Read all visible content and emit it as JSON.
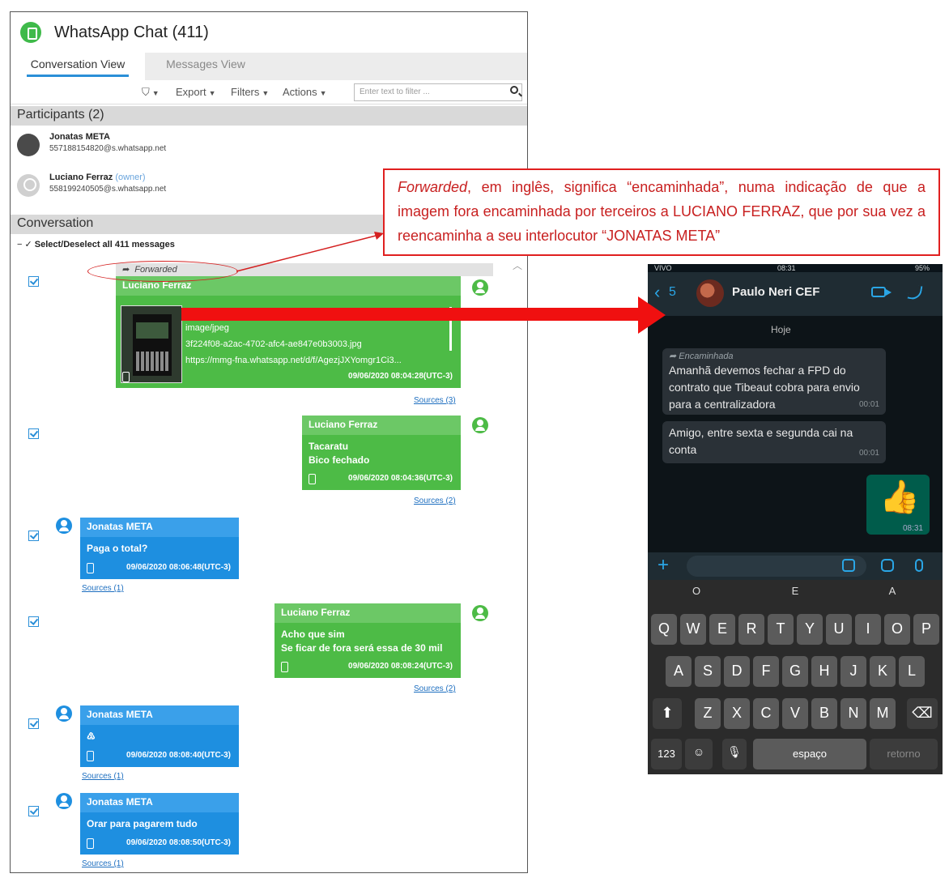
{
  "app": {
    "title": "WhatsApp Chat",
    "count": "(411)"
  },
  "tabs": [
    {
      "label": "Conversation View"
    },
    {
      "label": "Messages View"
    }
  ],
  "toolbar": {
    "export": "Export",
    "filters": "Filters",
    "actions": "Actions",
    "filter_placeholder": "Enter text to filter ..."
  },
  "participants": {
    "heading": "Participants (2)",
    "items": [
      {
        "name": "Jonatas META",
        "number": "557188154820@s.whatsapp.net",
        "tag": ""
      },
      {
        "name": "Luciano Ferraz",
        "number": "558199240505@s.whatsapp.net",
        "tag": "(owner)"
      }
    ]
  },
  "conversation": {
    "heading": "Conversation",
    "select_all": "Select/Deselect all 411 messages",
    "forwarded_label": "Forwarded",
    "messages": [
      {
        "sender": "Luciano Ferraz",
        "attachment_type": "image/jpeg",
        "attachment_file": "3f224f08-a2ac-4702-afc4-ae847e0b3003.jpg",
        "attachment_url": "https://mmg-fna.whatsapp.net/d/f/AgezjJXYomgr1Ci3...",
        "timestamp": "09/06/2020 08:04:28(UTC-3)",
        "sources": "Sources (3)"
      },
      {
        "sender": "Luciano Ferraz",
        "line1": "Tacaratu",
        "line2": "Bico fechado",
        "timestamp": "09/06/2020 08:04:36(UTC-3)",
        "sources": "Sources (2)"
      },
      {
        "sender": "Jonatas META",
        "line1": "Paga o total?",
        "timestamp": "09/06/2020 08:06:48(UTC-3)",
        "sources": "Sources (1)"
      },
      {
        "sender": "Luciano Ferraz",
        "line1": "Acho que sim",
        "line2": "Se ficar de fora será essa de 30 mil",
        "timestamp": "09/06/2020 08:08:24(UTC-3)",
        "sources": "Sources (2)"
      },
      {
        "sender": "Jonatas META",
        "line1": "♳",
        "timestamp": "09/06/2020 08:08:40(UTC-3)",
        "sources": "Sources (1)"
      },
      {
        "sender": "Jonatas META",
        "line1": "Orar para pagarem tudo",
        "timestamp": "09/06/2020 08:08:50(UTC-3)",
        "sources": "Sources (1)"
      }
    ]
  },
  "annotation": {
    "word": "Forwarded",
    "text": ", em inglês, significa “encaminhada”, numa indicação de que a imagem fora encaminhada por terceiros a LUCIANO FERRAZ, que por sua vez a reencaminha a seu interlocutor “JONATAS META”"
  },
  "phone": {
    "status_left": "VIVO",
    "status_time": "08:31",
    "status_right": "95%",
    "back_count": "5",
    "contact": "Paulo Neri CEF",
    "date_label": "Hoje",
    "forward_label": "Encaminhada",
    "msg1": "Amanhã devemos fechar a FPD do contrato que Tibeaut cobra para envio para a centralizadora",
    "msg1_time": "00:01",
    "msg2": "Amigo, entre sexta e segunda cai na conta",
    "msg2_time": "00:01",
    "sticker_time": "08:31",
    "predictions": [
      "O",
      "E",
      "A"
    ],
    "row1": [
      "Q",
      "W",
      "E",
      "R",
      "T",
      "Y",
      "U",
      "I",
      "O",
      "P"
    ],
    "row2": [
      "A",
      "S",
      "D",
      "F",
      "G",
      "H",
      "J",
      "K",
      "L"
    ],
    "row3": [
      "Z",
      "X",
      "C",
      "V",
      "B",
      "N",
      "M"
    ],
    "key_123": "123",
    "key_space": "espaço",
    "key_return": "retorno"
  },
  "colors": {
    "accent_green": "#4dbb46",
    "accent_blue": "#1e8fe0",
    "annotation_red": "#e02020"
  }
}
